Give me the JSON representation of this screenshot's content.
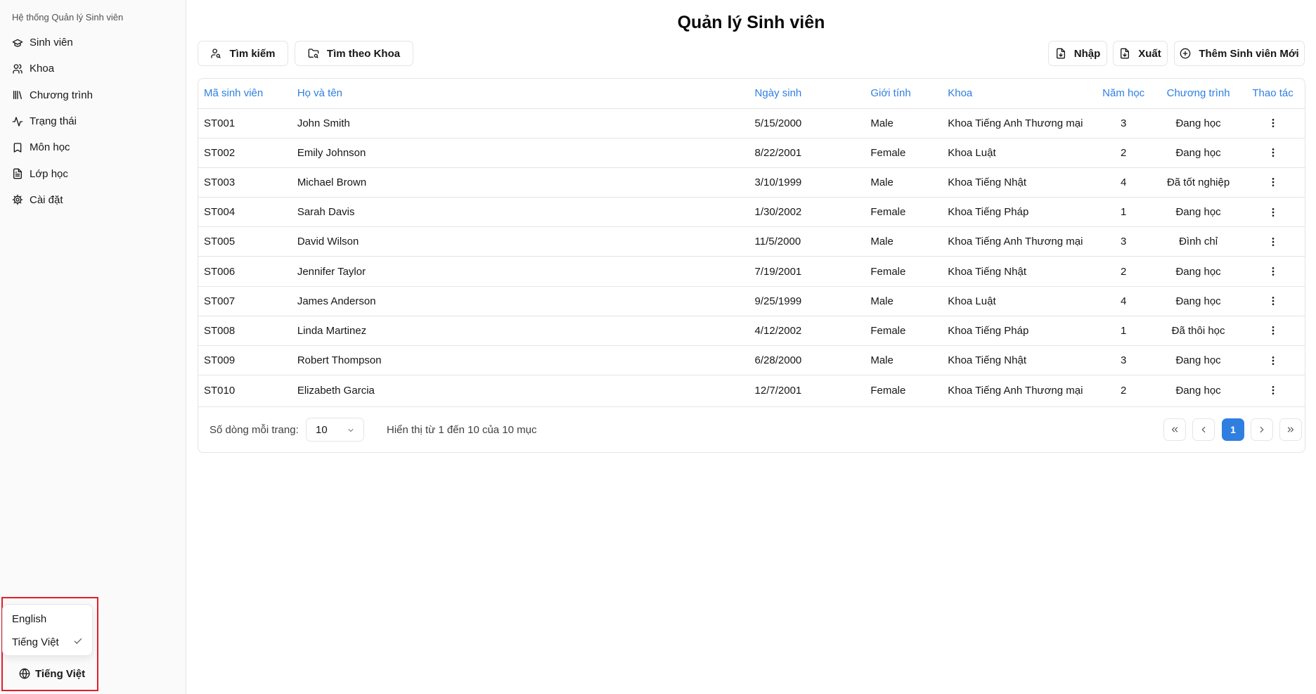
{
  "app": {
    "title": "Hệ thống Quản lý Sinh viên"
  },
  "sidebar": {
    "items": [
      {
        "label": "Sinh viên",
        "icon": "graduation-cap-icon"
      },
      {
        "label": "Khoa",
        "icon": "users-icon"
      },
      {
        "label": "Chương trình",
        "icon": "library-icon"
      },
      {
        "label": "Trạng thái",
        "icon": "activity-icon"
      },
      {
        "label": "Môn học",
        "icon": "bookmark-icon"
      },
      {
        "label": "Lớp học",
        "icon": "file-text-icon"
      },
      {
        "label": "Cài đặt",
        "icon": "settings-icon"
      }
    ]
  },
  "language": {
    "options": [
      {
        "label": "English",
        "selected": false
      },
      {
        "label": "Tiếng Việt",
        "selected": true
      }
    ],
    "current": "Tiếng Việt",
    "highlight_color": "#e11d2a"
  },
  "page": {
    "title": "Quản lý Sinh viên"
  },
  "toolbar": {
    "search_label": "Tìm kiếm",
    "search_by_faculty_label": "Tìm theo Khoa",
    "import_label": "Nhập",
    "export_label": "Xuất",
    "add_label": "Thêm Sinh viên Mới"
  },
  "table": {
    "headers": [
      "Mã sinh viên",
      "Họ và tên",
      "Ngày sinh",
      "Giới tính",
      "Khoa",
      "Năm học",
      "Chương trình",
      "Thao tác"
    ],
    "header_color": "#2f7fe0",
    "rows": [
      [
        "ST001",
        "John Smith",
        "5/15/2000",
        "Male",
        "Khoa Tiếng Anh Thương mại",
        "3",
        "Đang học"
      ],
      [
        "ST002",
        "Emily Johnson",
        "8/22/2001",
        "Female",
        "Khoa Luật",
        "2",
        "Đang học"
      ],
      [
        "ST003",
        "Michael Brown",
        "3/10/1999",
        "Male",
        "Khoa Tiếng Nhật",
        "4",
        "Đã tốt nghiệp"
      ],
      [
        "ST004",
        "Sarah Davis",
        "1/30/2002",
        "Female",
        "Khoa Tiếng Pháp",
        "1",
        "Đang học"
      ],
      [
        "ST005",
        "David Wilson",
        "11/5/2000",
        "Male",
        "Khoa Tiếng Anh Thương mại",
        "3",
        "Đình chỉ"
      ],
      [
        "ST006",
        "Jennifer Taylor",
        "7/19/2001",
        "Female",
        "Khoa Tiếng Nhật",
        "2",
        "Đang học"
      ],
      [
        "ST007",
        "James Anderson",
        "9/25/1999",
        "Male",
        "Khoa Luật",
        "4",
        "Đang học"
      ],
      [
        "ST008",
        "Linda Martinez",
        "4/12/2002",
        "Female",
        "Khoa Tiếng Pháp",
        "1",
        "Đã thôi học"
      ],
      [
        "ST009",
        "Robert Thompson",
        "6/28/2000",
        "Male",
        "Khoa Tiếng Nhật",
        "3",
        "Đang học"
      ],
      [
        "ST010",
        "Elizabeth Garcia",
        "12/7/2001",
        "Female",
        "Khoa Tiếng Anh Thương mại",
        "2",
        "Đang học"
      ]
    ]
  },
  "pagination": {
    "rows_per_page_label": "Số dòng mỗi trang:",
    "rows_per_page_value": "10",
    "showing_text": "Hiển thị từ 1 đến 10 của 10 mục",
    "current_page": "1",
    "accent_color": "#2f7fe0"
  }
}
